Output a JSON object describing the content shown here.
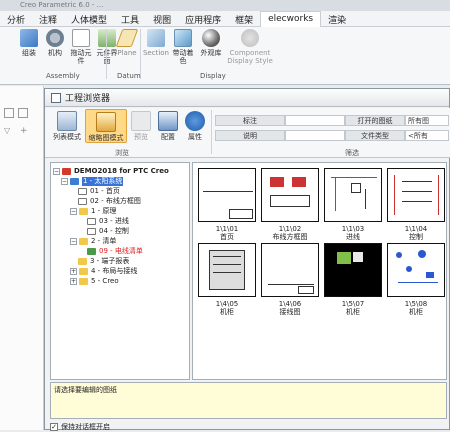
{
  "title_strip": "Creo Parametric 6.0 - ...",
  "menus": [
    "分析",
    "注释",
    "人体模型",
    "工具",
    "视图",
    "应用程序",
    "框架",
    "elecworks",
    "渲染"
  ],
  "ribbon": {
    "buttons": [
      "组装",
      "机构",
      "拖动元件",
      "元件界面",
      "Plane",
      "Section",
      "带动着色",
      "外观库",
      "Component Display Style"
    ],
    "groups": [
      "Assembly",
      "Datum",
      "Display"
    ]
  },
  "dialog": {
    "title": "工程浏览器",
    "buttons": {
      "list_mode": "列表模式",
      "thumb_mode": "缩略图模式",
      "preview": "预览",
      "config": "配置",
      "props": "属性"
    },
    "group_browse": "浏览",
    "group_filter": "筛选",
    "filter": {
      "label_tag": "标注",
      "label_desc": "说明",
      "opened": "打开的图纸",
      "opened_value": "所有图",
      "filetype": "文件类型",
      "filetype_value": "<所有"
    },
    "tree": [
      {
        "text": "DEMO2018 for PTC Creo",
        "level": 0,
        "icon": "project"
      },
      {
        "text": "1 - 太阳系统",
        "level": 1,
        "icon": "folder",
        "selected": true
      },
      {
        "text": "01 - 首页",
        "level": 2,
        "icon": "page"
      },
      {
        "text": "02 - 布线方框图",
        "level": 2,
        "icon": "page"
      },
      {
        "text": "1 - 原理",
        "level": 2,
        "icon": "folder"
      },
      {
        "text": "03 - 进线",
        "level": 3,
        "icon": "page"
      },
      {
        "text": "04 - 控制",
        "level": 3,
        "icon": "page"
      },
      {
        "text": "2 - 清单",
        "level": 2,
        "icon": "folder"
      },
      {
        "text": "09 - 电线清单",
        "level": 3,
        "icon": "list",
        "red": true
      },
      {
        "text": "3 - 端子报表",
        "level": 2,
        "icon": "folder"
      },
      {
        "text": "4 - 布局与接线",
        "level": 2,
        "icon": "folder"
      },
      {
        "text": "5 - Creo",
        "level": 2,
        "icon": "folder"
      }
    ],
    "thumbs": [
      {
        "code": "1\\1\\01",
        "name": "首页"
      },
      {
        "code": "1\\1\\02",
        "name": "布线方框图"
      },
      {
        "code": "1\\1\\03",
        "name": "进线"
      },
      {
        "code": "1\\1\\04",
        "name": "控制"
      },
      {
        "code": "1\\4\\05",
        "name": "机柜"
      },
      {
        "code": "1\\4\\06",
        "name": "接线图"
      },
      {
        "code": "1\\5\\07",
        "name": "机柜"
      },
      {
        "code": "1\\5\\08",
        "name": "机柜"
      }
    ],
    "message": "请选择要编辑的图纸",
    "keep_open": "保持对话框开启"
  }
}
